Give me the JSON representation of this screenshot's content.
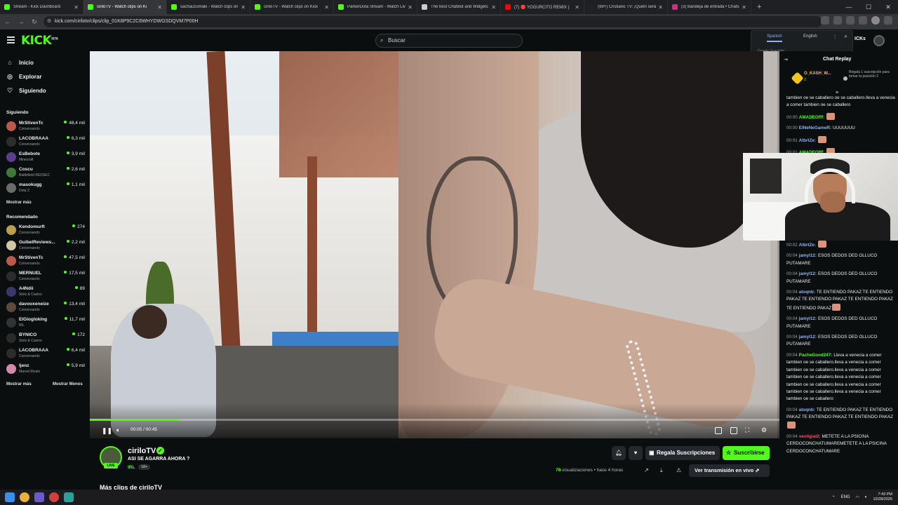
{
  "browser": {
    "tabs": [
      {
        "title": "Stream - Kick Dashboard",
        "color": "#53fc18"
      },
      {
        "title": "ciriloTV - Watch clips on Ki",
        "color": "#53fc18",
        "active": true
      },
      {
        "title": "sachauzumaki - Watch clips on",
        "color": "#53fc18"
      },
      {
        "title": "ciriloTV - Watch clips on Kick",
        "color": "#53fc18"
      },
      {
        "title": "ParkerDota Stream - Watch Liv",
        "color": "#53fc18"
      },
      {
        "title": "The best ChatBot and Widgets",
        "color": "#cccccc"
      },
      {
        "title": "(7) 🔴 YOGURCITO REMIX |",
        "color": "#ff0000"
      },
      {
        "title": "(99+) Cristiano TV: ¡Quién será",
        "color": "#222222"
      },
      {
        "title": "(3) Bandeja de entrada • Chats",
        "color": "#c13584"
      }
    ],
    "url": "kick.com/cirilotv/clips/clip_01K8P9C2C6WHYDWGSDQVM7P00H"
  },
  "header": {
    "logo": "KICK",
    "logo_sup": "BETA",
    "search_placeholder": "Buscar",
    "kicks_label": "ICKs"
  },
  "translate": {
    "lang_active": "Spanish",
    "lang_other": "English",
    "brand": "Google Translate"
  },
  "sidebar": {
    "nav": [
      {
        "label": "Inicio",
        "icon": "home-icon"
      },
      {
        "label": "Explorar",
        "icon": "compass-icon"
      },
      {
        "label": "Siguiendo",
        "icon": "heart-icon"
      }
    ],
    "following_title": "Siguiendo",
    "following": [
      {
        "name": "MrStivenTc",
        "category": "Conversando",
        "viewers": "48,4 mil",
        "color": "#b85a4a"
      },
      {
        "name": "LACOBRAAA",
        "category": "Conversando",
        "viewers": "6,3 mil",
        "color": "#2d2d2d"
      },
      {
        "name": "EsBebote",
        "category": "Minecraft",
        "viewers": "3,9 mil",
        "color": "#5b3f8e"
      },
      {
        "name": "Coscu",
        "category": "Battlefield REDSEC",
        "viewers": "2,6 mil",
        "color": "#3d7a3a"
      },
      {
        "name": "masokugg",
        "category": "Dota 2",
        "viewers": "1,1 mil",
        "color": "#6a6a6a"
      }
    ],
    "following_more": "Mostrar más",
    "recommended_title": "Recomendado",
    "recommended": [
      {
        "name": "Kendomurft",
        "category": "Conversando",
        "viewers": "274",
        "color": "#b8a14a"
      },
      {
        "name": "GuibelReviews...",
        "category": "Conversando",
        "viewers": "2,2 mil",
        "color": "#d4c7a8"
      },
      {
        "name": "MrStivenTc",
        "category": "Conversando",
        "viewers": "47,5 mil",
        "color": "#b85a4a"
      },
      {
        "name": "MERNUEL",
        "category": "Conversando",
        "viewers": "17,5 mil",
        "color": "#2c2c2c"
      },
      {
        "name": "A4Ndii",
        "category": "Slots & Casino",
        "viewers": "89",
        "color": "#3a3a6a"
      },
      {
        "name": "davooxeneize",
        "category": "Conversando",
        "viewers": "13,4 mil",
        "color": "#5d4a3a"
      },
      {
        "name": "ElGiogloking",
        "category": "IRL",
        "viewers": "11,7 mil",
        "color": "#333333"
      },
      {
        "name": "BYNICO",
        "category": "Slots & Casino",
        "viewers": "172",
        "color": "#2a2a2a"
      },
      {
        "name": "LACOBRAAA",
        "category": "Conversando",
        "viewers": "6,4 mil",
        "color": "#2d2d2d"
      },
      {
        "name": "ljenz",
        "category": "Marvel Rivals",
        "viewers": "5,9 mil",
        "color": "#d38aa8"
      }
    ],
    "recommended_more": "Mostrar más",
    "recommended_less": "Mostrar Menos"
  },
  "player": {
    "time": "00:05 / 00:45",
    "progress": 0.13
  },
  "chat": {
    "title": "Chat Replay",
    "pinned": {
      "user": "O_KASH_W...",
      "count": "2",
      "message": "Regala 1 suscripción para tomar la posición 2"
    },
    "messages": [
      {
        "time": "",
        "user": "",
        "color": "#ffffff",
        "text": "tambien oe se caballero oe se caballero.lleva a venecia a comer tambien oe se caballero"
      },
      {
        "time": "00:00",
        "user": "AMADEOfff:",
        "color": "#53fc18",
        "text": "",
        "emote": true
      },
      {
        "time": "00:00",
        "user": "ElNeNeGameR:",
        "color": "#8ab4f8",
        "text": "UUUUUUU"
      },
      {
        "time": "00:01",
        "user": "AlbrtZe:",
        "color": "#8ab4f8",
        "text": "",
        "emote": true
      },
      {
        "time": "00:01",
        "user": "AMADEOfff:",
        "color": "#53fc18",
        "text": "",
        "emote": true
      }
    ],
    "messages2": [
      {
        "time": "00:02",
        "user": "AlbrtZe:",
        "color": "#8ab4f8",
        "text": "",
        "emote": true
      },
      {
        "time": "00:04",
        "user": "jamyl12:",
        "color": "#8ab4f8",
        "text": "ESOS DEDOS DED OLLUCO PUTAMARE"
      },
      {
        "time": "00:04",
        "user": "jamyl12:",
        "color": "#8ab4f8",
        "text": "ESOS DEDOS DED OLLUCO PUTAMARE"
      },
      {
        "time": "00:04",
        "user": "atoqnb:",
        "color": "#8ab4f8",
        "text": "TE ENTIENDO PAKAZ TE ENTIENDO PAKAZ TE ENTIENDO PAKAZ TE ENTIENDO PAKAZ TE ENTIENDO PAKAZ",
        "emote": true
      },
      {
        "time": "00:04",
        "user": "jamyl12:",
        "color": "#8ab4f8",
        "text": "ESOS DEDOS DED OLLUCO PUTAMARE"
      },
      {
        "time": "00:04",
        "user": "jamyl12:",
        "color": "#8ab4f8",
        "text": "ESOS DEDOS DED OLLUCO PUTAMARE"
      },
      {
        "time": "00:04",
        "user": "PacheGood247:",
        "color": "#53fc18",
        "text": "Lleva a venecia a comer tambien oe se caballero.lleva a venecia a comer tambien oe se caballero.lleva a venecia a comer tambien oe se caballero.lleva a venecia a comer tambien oe se caballero.lleva a venecia a comer tambien oe se caballero.lleva a venecia a comer tambien oe se caballero"
      },
      {
        "time": "00:04",
        "user": "atoqnb:",
        "color": "#8ab4f8",
        "text": "TE ENTIENDO PAKAZ TE ENTIENDO PAKAZ TE ENTIENDO PAKAZ TE ENTIENDO PAKAZ",
        "emote": true
      },
      {
        "time": "00:04",
        "user": "vestigial2:",
        "color": "#ff4d6d",
        "text": "METETE A LA PSICINA CERDOCONCHATUMAREMETETE A LA PSICINA CERDOCONCHATUMARE"
      }
    ]
  },
  "channel": {
    "name": "ciriloTV",
    "live_badge": "LIVE",
    "clip_title": "ASI SE AGARRA AHORA ?",
    "category": "IRL",
    "age": "18+",
    "gift_label": "Regala Suscripciones",
    "subscribe_label": "Suscribirse",
    "views_count": "78",
    "views_label": "visualizaciones",
    "time_ago": "• hace 4 horas",
    "watch_live_label": "Ver transmisión en vivo",
    "more_clips": "Más clips de ciriloTV"
  },
  "taskbar": {
    "lang": "ENG",
    "time": "7:43 PM",
    "date": "10/28/2025"
  }
}
